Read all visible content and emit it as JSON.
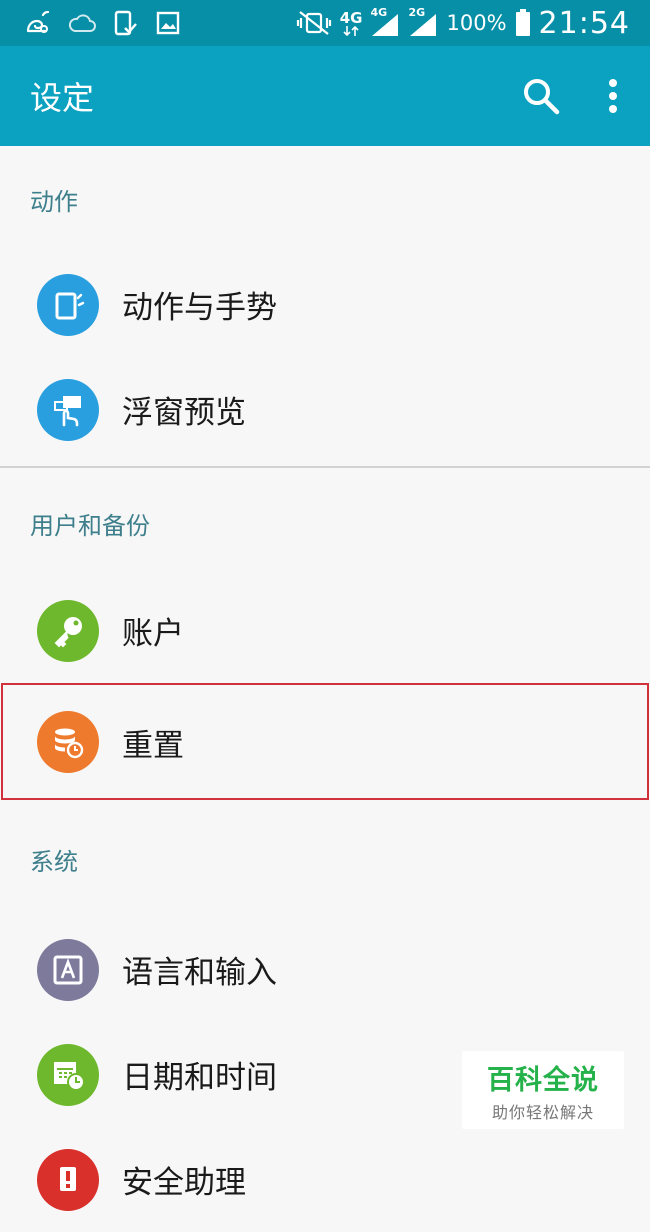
{
  "status_bar": {
    "network_4g": "4G",
    "signal_4g": "4G",
    "signal_2g": "2G",
    "battery": "100%",
    "time": "21:54",
    "icons": [
      "uc-browser-icon",
      "cloud-icon",
      "phone-check-icon",
      "image-icon",
      "vibrate-mute-icon",
      "battery-icon"
    ]
  },
  "app_bar": {
    "title": "设定",
    "icons": [
      "search-icon",
      "more-vert-icon"
    ]
  },
  "sections": {
    "actions": {
      "header": "动作",
      "items": [
        {
          "label": "动作与手势",
          "icon": "motion-gesture-icon",
          "color": "#2a9fe0"
        },
        {
          "label": "浮窗预览",
          "icon": "air-view-icon",
          "color": "#2a9fe0"
        }
      ]
    },
    "user_backup": {
      "header": "用户和备份",
      "items": [
        {
          "label": "账户",
          "icon": "key-icon",
          "color": "#6eb82d"
        },
        {
          "label": "重置",
          "icon": "reset-icon",
          "color": "#ee7a2e"
        }
      ]
    },
    "system": {
      "header": "系统",
      "items": [
        {
          "label": "语言和输入",
          "icon": "language-icon",
          "color": "#7d7a9c"
        },
        {
          "label": "日期和时间",
          "icon": "date-time-icon",
          "color": "#6eb82d"
        },
        {
          "label": "安全助理",
          "icon": "safety-icon",
          "color": "#d9302c"
        }
      ]
    }
  },
  "watermark": {
    "title": "百科全说",
    "subtitle": "助你轻松解决"
  }
}
